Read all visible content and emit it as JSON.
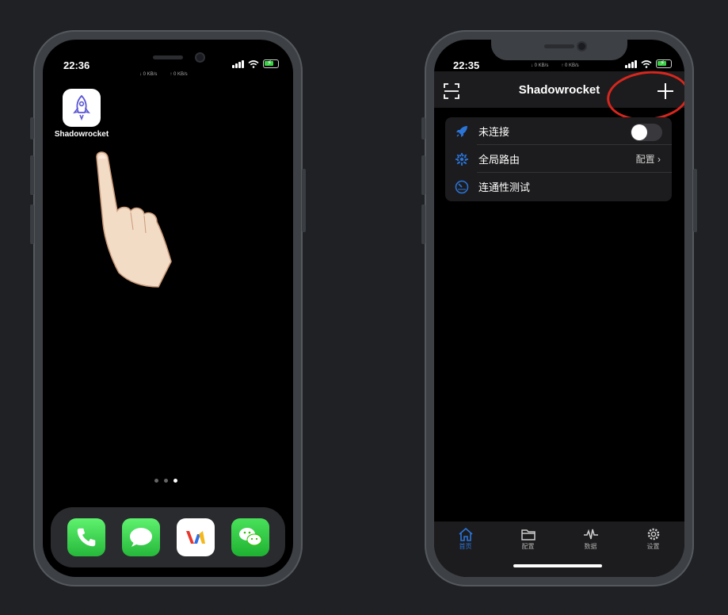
{
  "left_phone": {
    "status": {
      "time": "22:36",
      "down_speed": "↓ 0 KB/s",
      "up_speed": "↑ 0 KB/s"
    },
    "app": {
      "label": "Shadowrocket",
      "icon": "rocket-icon"
    },
    "page_dots": {
      "count": 3,
      "active": 3
    },
    "dock": [
      {
        "name": "phone-app-icon",
        "color": "#32c24d"
      },
      {
        "name": "messages-app-icon",
        "color": "#32c24d"
      },
      {
        "name": "vidmate-app-icon",
        "color": "#ffffff"
      },
      {
        "name": "wechat-app-icon",
        "color": "#2dc100"
      }
    ]
  },
  "right_phone": {
    "status": {
      "time": "22:35",
      "down_speed": "↓ 0 KB/s",
      "up_speed": "↑ 0 KB/s"
    },
    "nav": {
      "title": "Shadowrocket",
      "left_icon": "scan-icon",
      "right_icon": "plus-icon"
    },
    "rows": [
      {
        "label": "未连接",
        "icon": "rocket-icon",
        "toggle": false
      },
      {
        "label": "全局路由",
        "icon": "gear-icon",
        "value": "配置"
      },
      {
        "label": "连通性测试",
        "icon": "speedometer-icon"
      }
    ],
    "tabs": [
      {
        "label": "首页",
        "icon": "home-icon",
        "active": true
      },
      {
        "label": "配置",
        "icon": "folder-icon",
        "active": false
      },
      {
        "label": "数据",
        "icon": "pulse-icon",
        "active": false
      },
      {
        "label": "设置",
        "icon": "settings-icon",
        "active": false
      }
    ],
    "accent_color": "#2b74d8",
    "highlight_color": "#d8261d"
  }
}
